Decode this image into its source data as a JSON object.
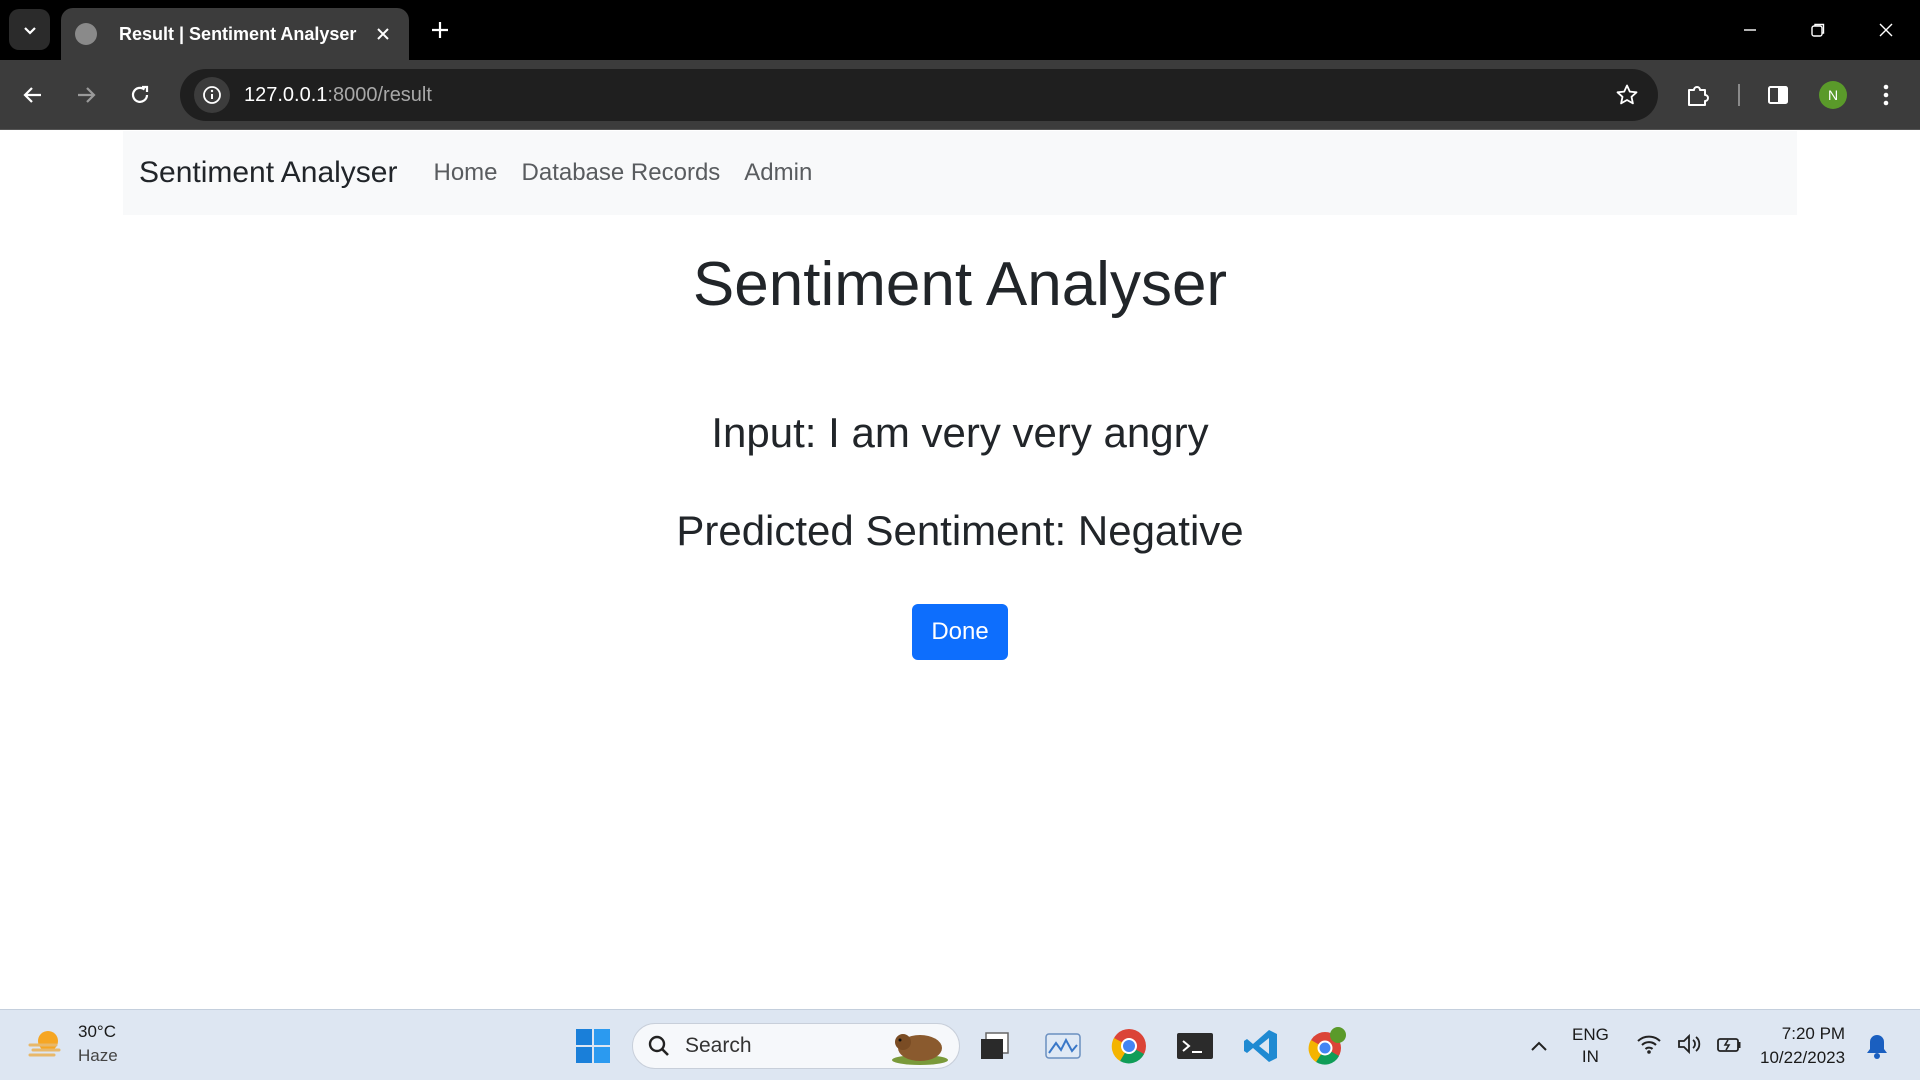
{
  "browser": {
    "tab_title": "Result | Sentiment Analyser",
    "url_host": "127.0.0.1",
    "url_path": ":8000/result",
    "profile_initial": "N"
  },
  "navbar": {
    "brand": "Sentiment Analyser",
    "links": [
      "Home",
      "Database Records",
      "Admin"
    ]
  },
  "main": {
    "title": "Sentiment Analyser",
    "input_line": "Input: I am very very angry",
    "prediction_line": "Predicted Sentiment: Negative",
    "done_label": "Done"
  },
  "taskbar": {
    "weather_temp": "30°C",
    "weather_condition": "Haze",
    "search_placeholder": "Search",
    "lang_line1": "ENG",
    "lang_line2": "IN",
    "time": "7:20 PM",
    "date": "10/22/2023",
    "pinned_icons": [
      "file-explorer-icon",
      "photos-icon",
      "chrome-icon",
      "terminal-icon",
      "vscode-icon",
      "chrome-profile-icon"
    ]
  },
  "colors": {
    "primary_button": "#0d6efd",
    "navbar_bg": "#f8f9fa",
    "taskbar_bg": "#dde6f2"
  }
}
